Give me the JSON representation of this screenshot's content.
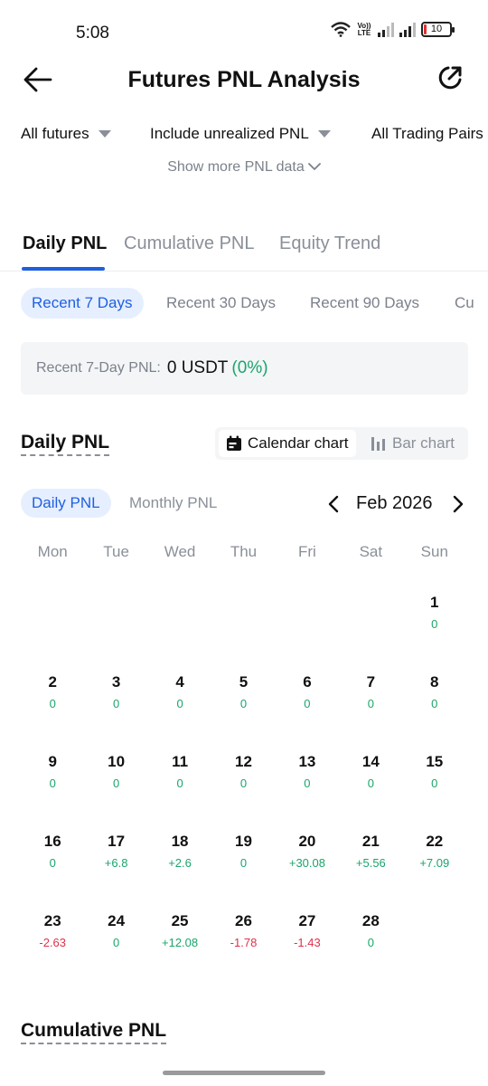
{
  "status_bar": {
    "time": "5:08",
    "volte_top": "Vo))",
    "volte_bottom": "LTE",
    "battery": "10"
  },
  "header": {
    "title": "Futures PNL Analysis"
  },
  "filters": {
    "futures": "All futures",
    "pnl": "Include unrealized PNL",
    "pairs": "All Trading Pairs",
    "show_more": "Show more PNL data"
  },
  "main_tabs": [
    "Daily PNL",
    "Cumulative PNL",
    "Equity Trend"
  ],
  "range_tabs": [
    "Recent 7 Days",
    "Recent 30 Days",
    "Recent 90 Days",
    "Cu"
  ],
  "summary": {
    "label": "Recent 7-Day PNL:",
    "value": "0 USDT",
    "pct": "(0%)"
  },
  "daily_section": {
    "title": "Daily PNL",
    "toggle_calendar": "Calendar chart",
    "toggle_bar": "Bar chart",
    "sub_tabs": [
      "Daily PNL",
      "Monthly PNL"
    ],
    "month": "Feb 2026"
  },
  "weekdays": [
    "Mon",
    "Tue",
    "Wed",
    "Thu",
    "Fri",
    "Sat",
    "Sun"
  ],
  "calendar": [
    {
      "day": "1",
      "pnl": "0",
      "sign": "pos"
    },
    {
      "day": "2",
      "pnl": "0",
      "sign": "pos"
    },
    {
      "day": "3",
      "pnl": "0",
      "sign": "pos"
    },
    {
      "day": "4",
      "pnl": "0",
      "sign": "pos"
    },
    {
      "day": "5",
      "pnl": "0",
      "sign": "pos"
    },
    {
      "day": "6",
      "pnl": "0",
      "sign": "pos"
    },
    {
      "day": "7",
      "pnl": "0",
      "sign": "pos"
    },
    {
      "day": "8",
      "pnl": "0",
      "sign": "pos"
    },
    {
      "day": "9",
      "pnl": "0",
      "sign": "pos"
    },
    {
      "day": "10",
      "pnl": "0",
      "sign": "pos"
    },
    {
      "day": "11",
      "pnl": "0",
      "sign": "pos"
    },
    {
      "day": "12",
      "pnl": "0",
      "sign": "pos"
    },
    {
      "day": "13",
      "pnl": "0",
      "sign": "pos"
    },
    {
      "day": "14",
      "pnl": "0",
      "sign": "pos"
    },
    {
      "day": "15",
      "pnl": "0",
      "sign": "pos"
    },
    {
      "day": "16",
      "pnl": "0",
      "sign": "pos"
    },
    {
      "day": "17",
      "pnl": "+6.8",
      "sign": "pos"
    },
    {
      "day": "18",
      "pnl": "+2.6",
      "sign": "pos"
    },
    {
      "day": "19",
      "pnl": "0",
      "sign": "pos"
    },
    {
      "day": "20",
      "pnl": "+30.08",
      "sign": "pos"
    },
    {
      "day": "21",
      "pnl": "+5.56",
      "sign": "pos"
    },
    {
      "day": "22",
      "pnl": "+7.09",
      "sign": "pos"
    },
    {
      "day": "23",
      "pnl": "-2.63",
      "sign": "neg"
    },
    {
      "day": "24",
      "pnl": "0",
      "sign": "pos"
    },
    {
      "day": "25",
      "pnl": "+12.08",
      "sign": "pos"
    },
    {
      "day": "26",
      "pnl": "-1.78",
      "sign": "neg"
    },
    {
      "day": "27",
      "pnl": "-1.43",
      "sign": "neg"
    },
    {
      "day": "28",
      "pnl": "0",
      "sign": "pos"
    }
  ],
  "cumulative_section": {
    "title": "Cumulative PNL"
  },
  "colors": {
    "accent": "#1f5fe0",
    "positive": "#1aa56b",
    "negative": "#e0304a",
    "muted": "#8a8f98"
  },
  "icons": [
    "back-arrow-icon",
    "share-icon",
    "caret-down-icon",
    "chevron-down-icon",
    "calendar-icon",
    "bar-chart-icon",
    "chevron-left-icon",
    "chevron-right-icon",
    "wifi-icon",
    "signal-icon",
    "battery-icon"
  ]
}
